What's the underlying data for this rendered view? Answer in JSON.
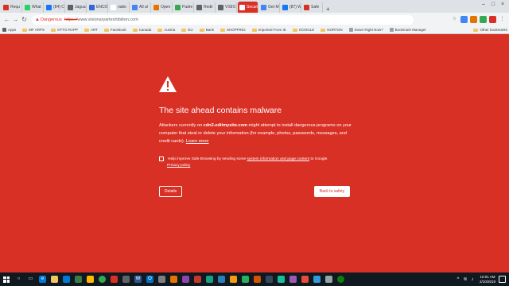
{
  "tabs": [
    {
      "label": "Requ",
      "favicon": "#d93025",
      "active": false
    },
    {
      "label": "What",
      "favicon": "#25d366",
      "active": false
    },
    {
      "label": "(84) C",
      "favicon": "#1877f2",
      "active": false
    },
    {
      "label": "Jagua",
      "favicon": "#5f6368",
      "active": false
    },
    {
      "label": "ENCO",
      "favicon": "#3367d6",
      "active": false
    },
    {
      "label": "natio",
      "favicon": "#ffffff",
      "active": false
    },
    {
      "label": "All al",
      "favicon": "#4285f4",
      "active": false
    },
    {
      "label": "Open",
      "favicon": "#e37400",
      "active": false
    },
    {
      "label": "Padre",
      "favicon": "#34a853",
      "active": false
    },
    {
      "label": "Redir",
      "favicon": "#5f6368",
      "active": false
    },
    {
      "label": "VISIO",
      "favicon": "#5f6368",
      "active": false
    },
    {
      "label": "Securi",
      "favicon": "#ffffff",
      "active": true
    },
    {
      "label": "Get M",
      "favicon": "#4285f4",
      "active": false
    },
    {
      "label": "(87) W",
      "favicon": "#1877f2",
      "active": false
    },
    {
      "label": "Safe",
      "favicon": "#d93025",
      "active": false
    }
  ],
  "toolbar": {
    "danger_label": "Dangerous",
    "url_scheme": "https://",
    "url_rest": "www.visionaryartexhibition.com"
  },
  "bookmarks": [
    {
      "label": "Apps",
      "kind": "apps"
    },
    {
      "label": "MF ARPS",
      "kind": "folder"
    },
    {
      "label": "OTTO RAPP",
      "kind": "folder"
    },
    {
      "label": "ART",
      "kind": "folder"
    },
    {
      "label": "Facebook",
      "kind": "folder"
    },
    {
      "label": "Canada",
      "kind": "folder"
    },
    {
      "label": "Austria",
      "kind": "folder"
    },
    {
      "label": "EU",
      "kind": "folder"
    },
    {
      "label": "Bank",
      "kind": "folder"
    },
    {
      "label": "SHOPPING",
      "kind": "folder"
    },
    {
      "label": "Imported From IE",
      "kind": "folder"
    },
    {
      "label": "GOOGLE",
      "kind": "folder"
    },
    {
      "label": "NORTON",
      "kind": "folder"
    },
    {
      "label": "Down Right Now?",
      "kind": "page"
    },
    {
      "label": "Bookmark Manager",
      "kind": "page"
    }
  ],
  "other_bookmarks": "Other bookmarks",
  "interstitial": {
    "heading": "The site ahead contains malware",
    "body_prefix": "Attackers currently on ",
    "body_site": "cdn2.editmysite.com",
    "body_suffix": " might attempt to install dangerous programs on your computer that steal or delete your information (for example, photos, passwords, messages, and credit cards). ",
    "learn_more": "Learn more",
    "checkbox_prefix": "Help improve Safe Browsing by sending some ",
    "checkbox_link": "system information and page content",
    "checkbox_suffix": " to Google.",
    "privacy_link": "Privacy policy",
    "details_button": "Details",
    "safety_button": "Back to safety"
  },
  "taskbar": {
    "time": "10:01 AM",
    "date": "2/10/2019"
  },
  "colors": {
    "danger_bg": "#d93025",
    "chrome_bg": "#f1f3f4",
    "taskbar_bg": "#101820"
  }
}
